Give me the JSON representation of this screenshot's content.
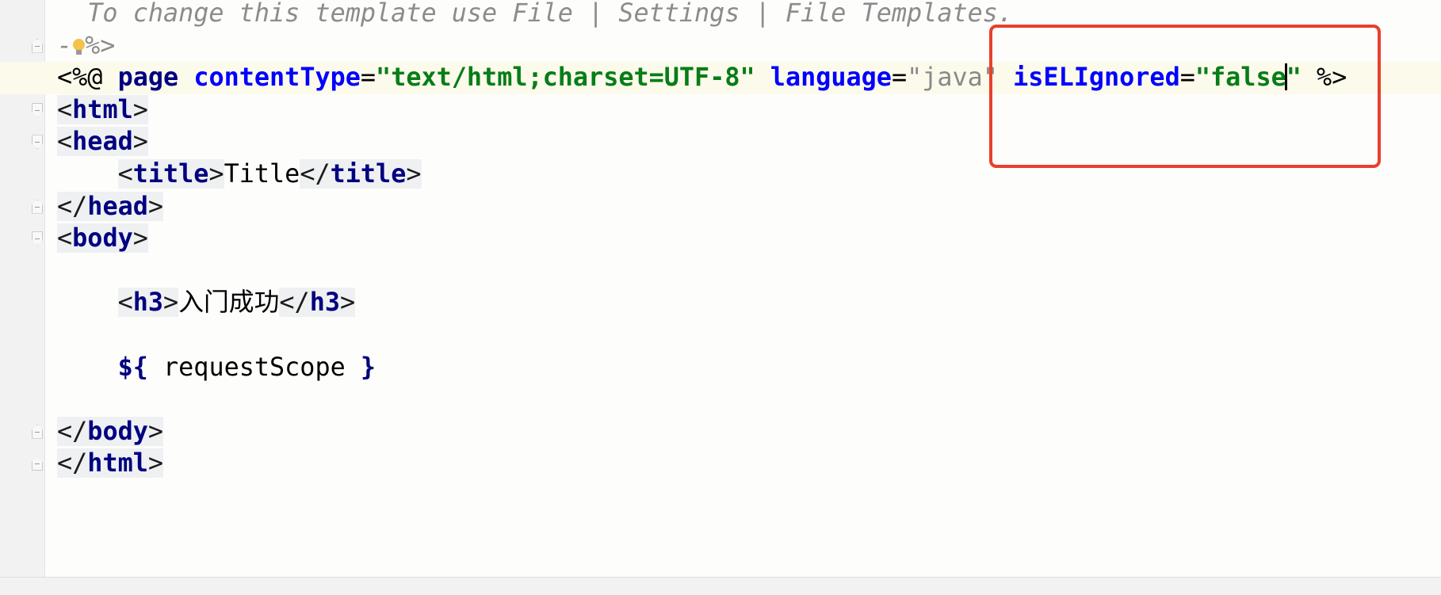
{
  "editor": {
    "lines": [
      {
        "fold": "",
        "current": false,
        "tokens": [
          {
            "t": "  To change this template use File | Settings | File Templates.",
            "k": "comment"
          }
        ]
      },
      {
        "fold": "close",
        "current": false,
        "bulb": true,
        "tokens": [
          {
            "t": "-",
            "k": "comment"
          },
          {
            "t": "BULB",
            "k": "bulb"
          },
          {
            "t": "%>",
            "k": "comment"
          }
        ]
      },
      {
        "fold": "",
        "current": true,
        "tokens": [
          {
            "t": "<%@ ",
            "k": "plain"
          },
          {
            "t": "page",
            "k": "directive"
          },
          {
            "t": " ",
            "k": "plain"
          },
          {
            "t": "contentType",
            "k": "attr"
          },
          {
            "t": "=",
            "k": "plain"
          },
          {
            "t": "\"text/html;charset=UTF-8\"",
            "k": "value"
          },
          {
            "t": " ",
            "k": "plain"
          },
          {
            "t": "language",
            "k": "attr"
          },
          {
            "t": "=",
            "k": "plain"
          },
          {
            "t": "\"java\"",
            "k": "value-dim"
          },
          {
            "t": " ",
            "k": "plain"
          },
          {
            "t": "isELIgnored",
            "k": "attr"
          },
          {
            "t": "=",
            "k": "plain"
          },
          {
            "t": "\"false",
            "k": "value"
          },
          {
            "t": "CARET",
            "k": "caret"
          },
          {
            "t": "\"",
            "k": "value"
          },
          {
            "t": " %>",
            "k": "plain"
          }
        ]
      },
      {
        "fold": "open",
        "current": false,
        "tokens": [
          {
            "t": "<",
            "k": "bracket"
          },
          {
            "t": "html",
            "k": "tag"
          },
          {
            "t": ">",
            "k": "bracket"
          }
        ]
      },
      {
        "fold": "open",
        "current": false,
        "tokens": [
          {
            "t": "<",
            "k": "bracket"
          },
          {
            "t": "head",
            "k": "tag"
          },
          {
            "t": ">",
            "k": "bracket"
          }
        ]
      },
      {
        "fold": "",
        "current": false,
        "tokens": [
          {
            "t": "    ",
            "k": "plain"
          },
          {
            "t": "<",
            "k": "bracket"
          },
          {
            "t": "title",
            "k": "tag"
          },
          {
            "t": ">",
            "k": "bracket"
          },
          {
            "t": "Title",
            "k": "text"
          },
          {
            "t": "</",
            "k": "bracket"
          },
          {
            "t": "title",
            "k": "tag"
          },
          {
            "t": ">",
            "k": "bracket"
          }
        ]
      },
      {
        "fold": "close",
        "current": false,
        "tokens": [
          {
            "t": "</",
            "k": "bracket"
          },
          {
            "t": "head",
            "k": "tag"
          },
          {
            "t": ">",
            "k": "bracket"
          }
        ]
      },
      {
        "fold": "open",
        "current": false,
        "tokens": [
          {
            "t": "<",
            "k": "bracket"
          },
          {
            "t": "body",
            "k": "tag"
          },
          {
            "t": ">",
            "k": "bracket"
          }
        ]
      },
      {
        "fold": "",
        "current": false,
        "tokens": []
      },
      {
        "fold": "",
        "current": false,
        "tokens": [
          {
            "t": "    ",
            "k": "plain"
          },
          {
            "t": "<",
            "k": "bracket"
          },
          {
            "t": "h3",
            "k": "tag"
          },
          {
            "t": ">",
            "k": "bracket"
          },
          {
            "t": "入门成功",
            "k": "text cjk"
          },
          {
            "t": "</",
            "k": "bracket"
          },
          {
            "t": "h3",
            "k": "tag"
          },
          {
            "t": ">",
            "k": "bracket"
          }
        ]
      },
      {
        "fold": "",
        "current": false,
        "tokens": []
      },
      {
        "fold": "",
        "current": false,
        "tokens": [
          {
            "t": "    ",
            "k": "plain"
          },
          {
            "t": "${",
            "k": "el"
          },
          {
            "t": " requestScope ",
            "k": "text"
          },
          {
            "t": "}",
            "k": "el"
          }
        ]
      },
      {
        "fold": "",
        "current": false,
        "tokens": []
      },
      {
        "fold": "close",
        "current": false,
        "tokens": [
          {
            "t": "</",
            "k": "bracket"
          },
          {
            "t": "body",
            "k": "tag"
          },
          {
            "t": ">",
            "k": "bracket"
          }
        ]
      },
      {
        "fold": "close",
        "current": false,
        "tokens": [
          {
            "t": "</",
            "k": "bracket"
          },
          {
            "t": "html",
            "k": "tag"
          },
          {
            "t": ">",
            "k": "bracket"
          }
        ]
      }
    ]
  },
  "annotation": {
    "color": "#e8402e"
  }
}
